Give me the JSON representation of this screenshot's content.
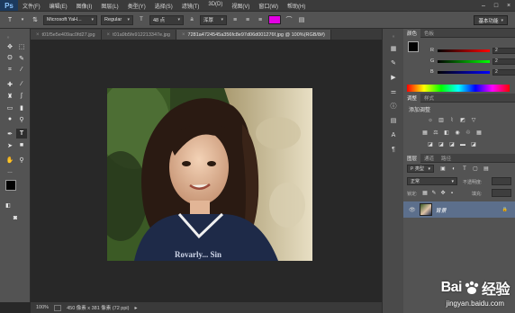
{
  "app": {
    "logo": "Ps"
  },
  "menus": [
    "文件(F)",
    "编辑(E)",
    "图像(I)",
    "图层(L)",
    "类型(Y)",
    "选择(S)",
    "滤镜(T)",
    "3D(D)",
    "视图(V)",
    "窗口(W)",
    "帮助(H)"
  ],
  "window_controls": {
    "minimize": "–",
    "maximize": "□",
    "close": "×"
  },
  "options": {
    "tool_glyph": "T",
    "orient_glyph": "⇅",
    "font_family": "Microsoft YaH...",
    "font_style": "Regular",
    "size_glyph": "T",
    "font_size": "48 点",
    "aa_prefix": "a",
    "antialias": "浑厚",
    "text_color": "#e400e4",
    "workspace": "基本功能"
  },
  "tabs": [
    {
      "label": "t01f5e5e409ac0fd27.jpg"
    },
    {
      "label": "t01a9b5fe912213347e.jpg"
    },
    {
      "label": "7281a4724545a356fc8e97d06d001276f.jpg @ 100%(RGB/8#)"
    }
  ],
  "status": {
    "zoom": "100%",
    "doc_info": "450 像素 x 381 像素 (72 ppi)"
  },
  "color_panel": {
    "tab_active": "颜色",
    "tab_other": "色板",
    "r_label": "R",
    "r_value": "2",
    "g_label": "G",
    "g_value": "2",
    "b_label": "B",
    "b_value": "2"
  },
  "adjust_panel": {
    "tab_active": "调整",
    "tab_other": "样式",
    "title": "添加调整"
  },
  "layers_panel": {
    "tab_active": "图层",
    "tab_channels": "通道",
    "tab_paths": "路径",
    "kind_prefix": "ρ",
    "kind": "类型",
    "blend_mode": "正常",
    "opacity_label": "不透明度:",
    "lock_label": "锁定:",
    "fill_label": "填充:",
    "layer_name": "背景",
    "visibility_glyph": "👁",
    "lock_glyph": "🔒"
  },
  "watermark": {
    "brand_left": "Bai",
    "brand_right": "经验",
    "url": "jingyan.baidu.com"
  }
}
